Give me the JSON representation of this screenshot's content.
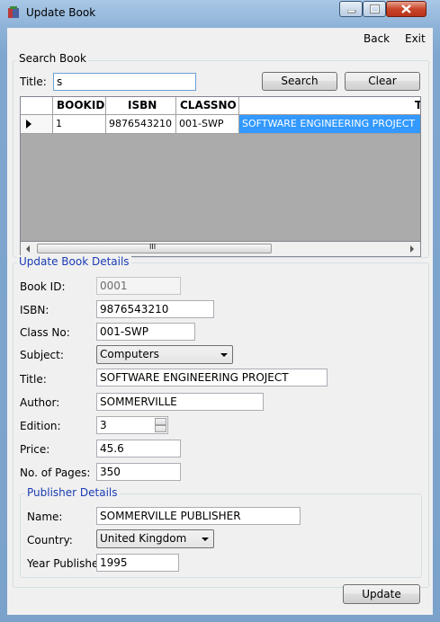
{
  "window": {
    "title": "Update Book"
  },
  "menu": {
    "back": "Back",
    "exit": "Exit"
  },
  "search": {
    "group_label": "Search Book",
    "title_label": "Title:",
    "title_value": "s",
    "search_button": "Search",
    "clear_button": "Clear"
  },
  "grid": {
    "columns": [
      "BOOKID",
      "ISBN",
      "CLASSNO",
      "T"
    ],
    "rows": [
      {
        "bookid": "1",
        "isbn": "9876543210",
        "classno": "001-SWP",
        "title": "SOFTWARE ENGINEERING PROJECT"
      }
    ],
    "scroll_grip": "III"
  },
  "details": {
    "group_label": "Update Book Details",
    "book_id_label": "Book ID:",
    "book_id_value": "0001",
    "isbn_label": "ISBN:",
    "isbn_value": "9876543210",
    "class_label": "Class No:",
    "class_value": "001-SWP",
    "subject_label": "Subject:",
    "subject_value": "Computers",
    "title_label": "Title:",
    "title_value": "SOFTWARE ENGINEERING PROJECT",
    "author_label": "Author:",
    "author_value": "SOMMERVILLE",
    "edition_label": "Edition:",
    "edition_value": "3",
    "price_label": "Price:",
    "price_value": "45.6",
    "pages_label": "No. of Pages:",
    "pages_value": "350"
  },
  "publisher": {
    "group_label": "Publisher Details",
    "name_label": "Name:",
    "name_value": "SOMMERVILLE PUBLISHER",
    "country_label": "Country:",
    "country_value": "United Kingdom",
    "year_label": "Year Published:",
    "year_value": "1995"
  },
  "actions": {
    "update_button": "Update"
  },
  "colors": {
    "group_label": "#1a3bb3",
    "selection": "#3399ff"
  }
}
